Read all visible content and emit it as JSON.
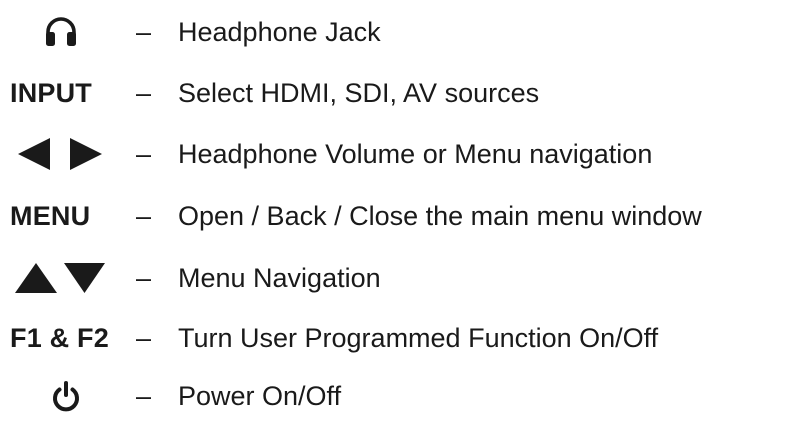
{
  "legend": {
    "dash": "–",
    "items": [
      {
        "key_icon": "headphones-icon",
        "key_label": "",
        "description": "Headphone Jack"
      },
      {
        "key_icon": "",
        "key_label": "INPUT",
        "description": "Select HDMI, SDI, AV sources"
      },
      {
        "key_icon": "left-right-triangle-arrows-icon",
        "key_label": "",
        "description": "Headphone Volume or Menu navigation"
      },
      {
        "key_icon": "",
        "key_label": "MENU",
        "description": "Open / Back / Close the main menu window"
      },
      {
        "key_icon": "up-down-triangle-arrows-icon",
        "key_label": "",
        "description": "Menu Navigation"
      },
      {
        "key_icon": "",
        "key_label": "F1 & F2",
        "description": "Turn User Programmed Function On/Off"
      },
      {
        "key_icon": "power-icon",
        "key_label": "",
        "description": "Power On/Off"
      }
    ]
  },
  "colors": {
    "text": "#1a1a1a",
    "background": "#ffffff"
  }
}
